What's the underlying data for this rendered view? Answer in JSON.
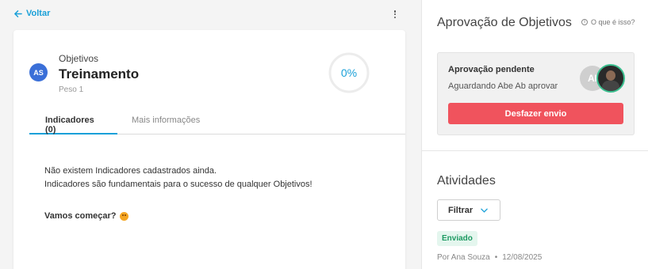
{
  "nav": {
    "back_label": "Voltar"
  },
  "objective": {
    "type": "Objetivos",
    "title": "Treinamento",
    "weight": "Peso 1",
    "owner_initials": "AS",
    "progress": "0%"
  },
  "tabs": [
    {
      "label": "Indicadores (0)",
      "active": true
    },
    {
      "label": "Mais informações",
      "active": false
    }
  ],
  "empty_state": {
    "line1": "Não existem Indicadores cadastrados ainda.",
    "line2": "Indicadores são fundamentais para o sucesso de qualquer Objetivos!",
    "cta": "Vamos começar?"
  },
  "approval": {
    "title": "Aprovação de Objetivos",
    "help": "O que é isso?",
    "status_title": "Aprovação pendente",
    "status_text": "Aguardando Abe Ab aprovar",
    "approver_initials": "AI",
    "undo_label": "Desfazer envio"
  },
  "activities": {
    "title": "Atividades",
    "filter_label": "Filtrar",
    "items": [
      {
        "badge": "Enviado",
        "author": "Por Ana Souza",
        "separator": "•",
        "date": "12/08/2025"
      }
    ]
  },
  "colors": {
    "accent": "#1aa0d8",
    "danger": "#f0535d",
    "success": "#1d9a62"
  }
}
